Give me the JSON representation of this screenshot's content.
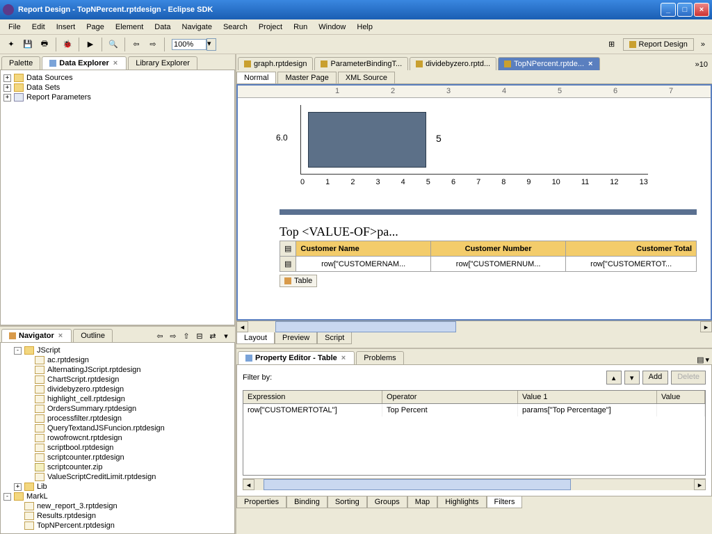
{
  "window": {
    "title": "Report Design - TopNPercent.rptdesign - Eclipse SDK"
  },
  "menu": [
    "File",
    "Edit",
    "Insert",
    "Page",
    "Element",
    "Data",
    "Navigate",
    "Search",
    "Project",
    "Run",
    "Window",
    "Help"
  ],
  "toolbar": {
    "zoom": "100%",
    "perspective_label": "Report Design"
  },
  "left_tabs": {
    "palette": "Palette",
    "data_explorer": "Data Explorer",
    "library_explorer": "Library Explorer"
  },
  "data_explorer_tree": [
    {
      "label": "Data Sources",
      "collapsed": true
    },
    {
      "label": "Data Sets",
      "collapsed": true
    },
    {
      "label": "Report Parameters",
      "collapsed": true
    }
  ],
  "navigator_tabs": {
    "navigator": "Navigator",
    "outline": "Outline"
  },
  "navigator_tree": {
    "root1": "JScript",
    "items1": [
      "ac.rptdesign",
      "AlternatingJScript.rptdesign",
      "ChartScript.rptdesign",
      "dividebyzero.rptdesign",
      "highlight_cell.rptdesign",
      "OrdersSummary.rptdesign",
      "processfilter.rptdesign",
      "QueryTextandJSFuncion.rptdesign",
      "rowofrowcnt.rptdesign",
      "scriptbool.rptdesign",
      "scriptcounter.rptdesign",
      "scriptcounter.zip",
      "ValueScriptCreditLimit.rptdesign"
    ],
    "lib": "Lib",
    "root2": "MarkL",
    "items2": [
      "new_report_3.rptdesign",
      "Results.rptdesign",
      "TopNPercent.rptdesign"
    ]
  },
  "editor_tabs": [
    {
      "label": "graph.rptdesign",
      "active": false
    },
    {
      "label": "ParameterBindingT...",
      "active": false
    },
    {
      "label": "dividebyzero.rptd...",
      "active": false
    },
    {
      "label": "TopNPercent.rptde...",
      "active": true
    }
  ],
  "editor_count": "»10",
  "editor_subtabs": [
    "Normal",
    "Master Page",
    "XML Source"
  ],
  "chart_data": {
    "type": "bar",
    "orientation": "horizontal",
    "ylabel": "6.0",
    "values": [
      5
    ],
    "xlim": [
      0,
      13
    ],
    "x_ticks": [
      0,
      1,
      2,
      3,
      4,
      5,
      6,
      7,
      8,
      9,
      10,
      11,
      12,
      13
    ]
  },
  "design_heading": "Top <VALUE-OF>pa...",
  "design_table": {
    "headers": [
      "Customer Name",
      "Customer Number",
      "Customer Total"
    ],
    "row": [
      "row[\"CUSTOMERNAM...",
      "row[\"CUSTOMERNUM...",
      "row[\"CUSTOMERTOT..."
    ]
  },
  "table_chip": "Table",
  "layout_tabs": [
    "Layout",
    "Preview",
    "Script"
  ],
  "property_editor": {
    "title": "Property Editor - Table",
    "problems_tab": "Problems",
    "filter_label": "Filter by:",
    "buttons": {
      "add": "Add",
      "delete": "Delete"
    },
    "columns": [
      "Expression",
      "Operator",
      "Value 1",
      "Value"
    ],
    "rows": [
      {
        "expr": "row[\"CUSTOMERTOTAL\"]",
        "op": "Top Percent",
        "v1": "params[\"Top Percentage\"]",
        "v2": ""
      }
    ],
    "bottom_tabs": [
      "Properties",
      "Binding",
      "Sorting",
      "Groups",
      "Map",
      "Highlights",
      "Filters"
    ]
  }
}
